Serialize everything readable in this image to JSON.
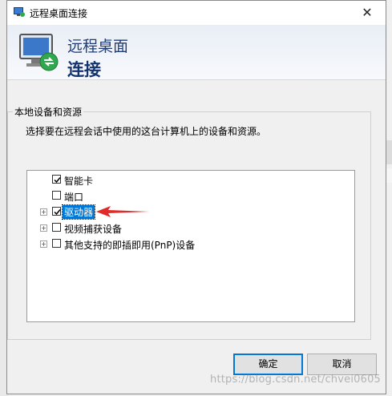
{
  "window": {
    "title": "远程桌面连接",
    "close_glyph": "✕"
  },
  "header": {
    "line1": "远程桌面",
    "line2": "连接"
  },
  "group": {
    "title": "本地设备和资源",
    "description": "选择要在远程会话中使用的这台计算机上的设备和资源。"
  },
  "tree": {
    "items": [
      {
        "label": "智能卡",
        "checked": true,
        "expandable": false
      },
      {
        "label": "端口",
        "checked": false,
        "expandable": false
      },
      {
        "label": "驱动器",
        "checked": true,
        "expandable": true,
        "selected": true
      },
      {
        "label": "视频捕获设备",
        "checked": false,
        "expandable": true
      },
      {
        "label": "其他支持的即插即用(PnP)设备",
        "checked": false,
        "expandable": true
      }
    ]
  },
  "buttons": {
    "ok": "确定",
    "cancel": "取消"
  },
  "watermark": "https://blog.csdn.net/chvei0605",
  "colors": {
    "selection": "#0078d7",
    "arrow": "#e02b2b",
    "header_text": "#1f3d7a"
  }
}
